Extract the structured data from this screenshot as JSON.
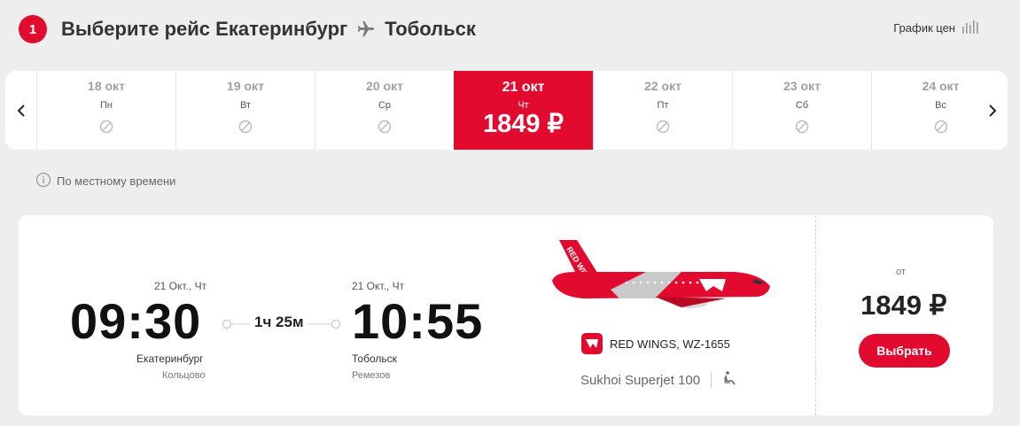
{
  "header": {
    "step": "1",
    "title_prefix": "Выберите рейс",
    "origin": "Екатеринбург",
    "destination": "Тобольск",
    "price_chart_label": "График цен"
  },
  "date_strip": {
    "days": [
      {
        "date": "18 окт",
        "weekday": "Пн"
      },
      {
        "date": "19 окт",
        "weekday": "Вт"
      },
      {
        "date": "20 окт",
        "weekday": "Ср"
      },
      {
        "date": "21 окт",
        "weekday": "Чт",
        "price": "1849 ₽"
      },
      {
        "date": "22 окт",
        "weekday": "Пт"
      },
      {
        "date": "23 окт",
        "weekday": "Сб"
      },
      {
        "date": "24 окт",
        "weekday": "Вс"
      }
    ]
  },
  "local_time_note": "По местному времени",
  "flight": {
    "departure": {
      "date": "21 Окт., Чт",
      "time": "09:30",
      "city": "Екатеринбург",
      "airport": "Кольцово"
    },
    "duration": "1ч 25м",
    "arrival": {
      "date": "21 Окт., Чт",
      "time": "10:55",
      "city": "Тобольск",
      "airport": "Ремезов"
    },
    "airline": "RED WINGS, WZ-1655",
    "aircraft": "Sukhoi Superjet 100",
    "price_from": "от",
    "price": "1849 ₽",
    "select_label": "Выбрать"
  },
  "colors": {
    "accent": "#e30a2f"
  }
}
